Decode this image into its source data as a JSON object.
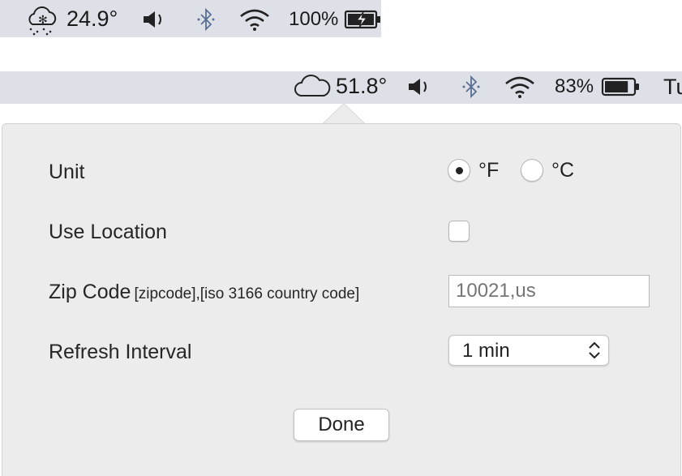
{
  "menubar_top": {
    "temperature": "24.9°",
    "battery": "100%",
    "weather_icon": "cloud-snow-icon",
    "volume_icon": "volume-icon",
    "bluetooth_icon": "bluetooth-icon",
    "wifi_icon": "wifi-icon",
    "battery_icon": "battery-charging-icon"
  },
  "menubar_second": {
    "temperature": "51.8°",
    "battery": "83%",
    "battery_level": 0.83,
    "clock_partial": "Tu",
    "weather_icon": "cloud-icon",
    "volume_icon": "volume-icon",
    "bluetooth_icon": "bluetooth-icon",
    "wifi_icon": "wifi-icon",
    "battery_icon": "battery-icon"
  },
  "preferences": {
    "unit_label": "Unit",
    "unit_options": [
      "°F",
      "°C"
    ],
    "unit_selected": "°F",
    "use_location_label": "Use Location",
    "use_location_checked": false,
    "zip_code_label": "Zip Code",
    "zip_code_hint": "[zipcode],[iso 3166 country code]",
    "zip_code_placeholder": "10021,us",
    "zip_code_value": "",
    "refresh_interval_label": "Refresh Interval",
    "refresh_interval_value": "1 min",
    "done_label": "Done"
  }
}
